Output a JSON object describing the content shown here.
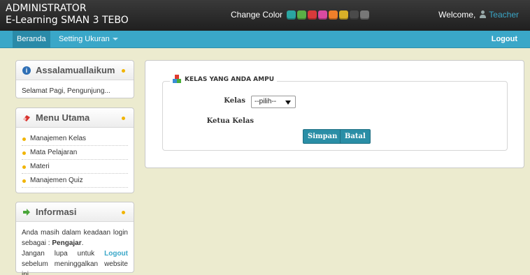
{
  "header": {
    "brand_line1": "ADMINISTRATOR",
    "brand_line2": "E-Learning SMAN 3 TEBO",
    "change_color_label": "Change Color",
    "color_swatches": [
      {
        "name": "teal",
        "color": "#2aa6a2"
      },
      {
        "name": "green",
        "color": "#5ab046"
      },
      {
        "name": "red",
        "color": "#d83a3a"
      },
      {
        "name": "pink",
        "color": "#d94aa0"
      },
      {
        "name": "orange",
        "color": "#f07f2a"
      },
      {
        "name": "yellow",
        "color": "#d8b028"
      },
      {
        "name": "dark",
        "color": "#4a4a4a"
      },
      {
        "name": "gray",
        "color": "#777777"
      }
    ],
    "welcome_label": "Welcome,",
    "user_name": "Teacher"
  },
  "nav": {
    "home_label": "Beranda",
    "setting_label": "Setting Ukuran",
    "logout_label": "Logout"
  },
  "sidebar": {
    "greeting": {
      "title": "Assalamuallaikum",
      "text": "Selamat Pagi, Pengunjung..."
    },
    "menu": {
      "title": "Menu Utama",
      "items": [
        {
          "label": "Manajemen Kelas"
        },
        {
          "label": "Mata Pelajaran"
        },
        {
          "label": "Materi"
        },
        {
          "label": "Manajemen Quiz"
        }
      ]
    },
    "info": {
      "title": "Informasi",
      "text1": "Anda masih dalam keadaan login sebagai :",
      "role": "Pengajar",
      "text2_a": "Jangan lupa untuk",
      "logout_link": "Logout",
      "text2_b": "sebelum meninggalkan website ini."
    }
  },
  "main": {
    "legend": "KELAS YANG ANDA AMPU",
    "kelas_label": "Kelas",
    "kelas_value": "--pilih--",
    "ketua_label": "Ketua Kelas",
    "save_label": "Simpan",
    "cancel_label": "Batal"
  },
  "colors": {
    "accent": "#3aa7c8",
    "button": "#2a8ea6",
    "background": "#ecebcf",
    "dot": "#f1b400"
  }
}
